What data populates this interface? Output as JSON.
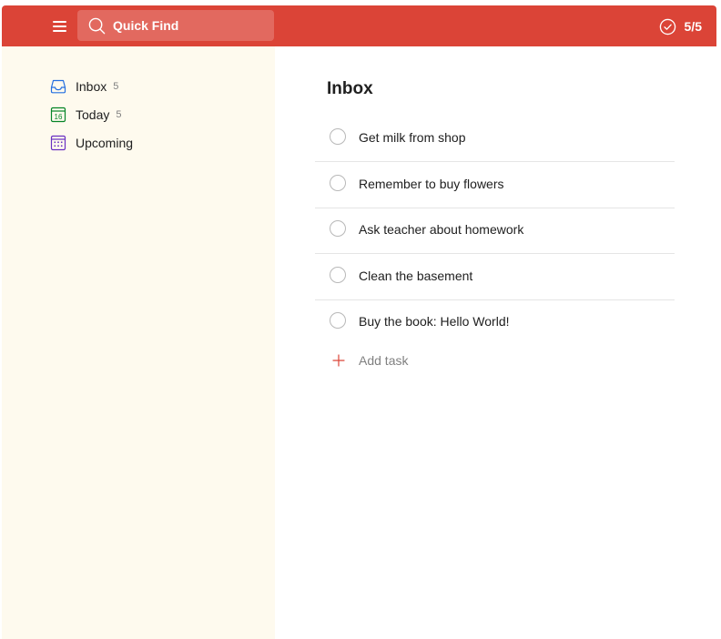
{
  "topbar": {
    "menu_icon": "hamburger-menu-icon",
    "search_placeholder": "Quick Find",
    "karma_icon": "check-circle-icon",
    "karma_progress": "5/5"
  },
  "sidebar": {
    "items": [
      {
        "label": "Inbox",
        "count": "5",
        "icon": "inbox-icon"
      },
      {
        "label": "Today",
        "count": "5",
        "icon": "calendar-today-icon"
      },
      {
        "label": "Upcoming",
        "count": "",
        "icon": "calendar-grid-icon"
      }
    ]
  },
  "main": {
    "title": "Inbox",
    "tasks": [
      {
        "text": "Get milk from shop"
      },
      {
        "text": "Remember to buy flowers"
      },
      {
        "text": "Ask teacher about homework"
      },
      {
        "text": "Clean the basement"
      },
      {
        "text": "Buy the book: Hello World!"
      }
    ],
    "add_task_label": "Add task"
  },
  "today_icon_day": "16",
  "colors": {
    "brand": "#db4437",
    "sidebar_bg": "#fefaee",
    "inbox_icon": "#246fe0",
    "today_icon": "#058527",
    "upcoming_icon": "#692fc2"
  }
}
